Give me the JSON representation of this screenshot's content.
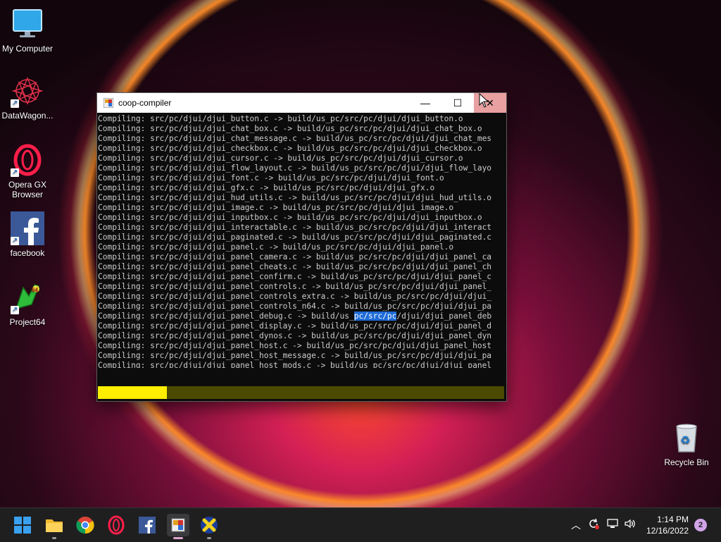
{
  "desktop_icons": [
    {
      "label": "My Computer",
      "icon": "monitor-icon",
      "shortcut": false
    },
    {
      "label": "DataWagon...",
      "icon": "datawagon-icon",
      "shortcut": true
    },
    {
      "label": "Opera GX Browser",
      "icon": "opera-gx-icon",
      "shortcut": true
    },
    {
      "label": "facebook",
      "icon": "facebook-icon",
      "shortcut": true
    },
    {
      "label": "Project64",
      "icon": "project64-icon",
      "shortcut": true
    },
    {
      "label": "Recycle Bin",
      "icon": "recycle-bin-icon",
      "shortcut": false
    }
  ],
  "window": {
    "title": "coop-compiler",
    "minimize_glyph": "—",
    "maximize_glyph": "☐",
    "close_glyph": "✕",
    "console_lines": [
      "Compiling: src/pc/djui/djui_button.c -> build/us_pc/src/pc/djui/djui_button.o",
      "Compiling: src/pc/djui/djui_chat_box.c -> build/us_pc/src/pc/djui/djui_chat_box.o",
      "Compiling: src/pc/djui/djui_chat_message.c -> build/us_pc/src/pc/djui/djui_chat_mes",
      "Compiling: src/pc/djui/djui_checkbox.c -> build/us_pc/src/pc/djui/djui_checkbox.o",
      "Compiling: src/pc/djui/djui_cursor.c -> build/us_pc/src/pc/djui/djui_cursor.o",
      "Compiling: src/pc/djui/djui_flow_layout.c -> build/us_pc/src/pc/djui/djui_flow_layo",
      "Compiling: src/pc/djui/djui_font.c -> build/us_pc/src/pc/djui/djui_font.o",
      "Compiling: src/pc/djui/djui_gfx.c -> build/us_pc/src/pc/djui/djui_gfx.o",
      "Compiling: src/pc/djui/djui_hud_utils.c -> build/us_pc/src/pc/djui/djui_hud_utils.o",
      "Compiling: src/pc/djui/djui_image.c -> build/us_pc/src/pc/djui/djui_image.o",
      "Compiling: src/pc/djui/djui_inputbox.c -> build/us_pc/src/pc/djui/djui_inputbox.o",
      "Compiling: src/pc/djui/djui_interactable.c -> build/us_pc/src/pc/djui/djui_interact",
      "Compiling: src/pc/djui/djui_paginated.c -> build/us_pc/src/pc/djui/djui_paginated.c",
      "Compiling: src/pc/djui/djui_panel.c -> build/us_pc/src/pc/djui/djui_panel.o",
      "Compiling: src/pc/djui/djui_panel_camera.c -> build/us_pc/src/pc/djui/djui_panel_ca",
      "Compiling: src/pc/djui/djui_panel_cheats.c -> build/us_pc/src/pc/djui/djui_panel_ch",
      "Compiling: src/pc/djui/djui_panel_confirm.c -> build/us_pc/src/pc/djui/djui_panel_c",
      "Compiling: src/pc/djui/djui_panel_controls.c -> build/us_pc/src/pc/djui/djui_panel_",
      "Compiling: src/pc/djui/djui_panel_controls_extra.c -> build/us_pc/src/pc/djui/djui_",
      "Compiling: src/pc/djui/djui_panel_controls_n64.c -> build/us_pc/src/pc/djui/djui_pa",
      "Compiling: src/pc/djui/djui_panel_debug.c -> build/us_pc/src/pc/djui/djui_panel_deb",
      "Compiling: src/pc/djui/djui_panel_display.c -> build/us_pc/src/pc/djui/djui_panel_d",
      "Compiling: src/pc/djui/djui_panel_dynos.c -> build/us_pc/src/pc/djui/djui_panel_dyn",
      "Compiling: src/pc/djui/djui_panel_host.c -> build/us_pc/src/pc/djui/djui_panel_host",
      "Compiling: src/pc/djui/djui_panel_host_message.c -> build/us_pc/src/pc/djui/djui_pa",
      "Compiling: src/pc/djui/djui_panel_host_mods.c -> build/us_pc/src/pc/djui/djui_panel"
    ],
    "selected_text": "pc/src/pc",
    "progress_fraction": 0.17,
    "progress_color": "#ffee00",
    "progress_track_color": "#4b4a00"
  },
  "taskbar": {
    "items": [
      {
        "icon": "windows-start-icon",
        "active": false,
        "indicator": false
      },
      {
        "icon": "file-explorer-icon",
        "active": false,
        "indicator": true
      },
      {
        "icon": "chrome-icon",
        "active": false,
        "indicator": false
      },
      {
        "icon": "opera-gx-icon",
        "active": false,
        "indicator": false
      },
      {
        "icon": "facebook-icon",
        "active": false,
        "indicator": false
      },
      {
        "icon": "coop-compiler-icon",
        "active": true,
        "indicator": true
      },
      {
        "icon": "project64-icon",
        "active": false,
        "indicator": true
      }
    ],
    "tray": {
      "chevron_glyph": "︿",
      "time": "1:14 PM",
      "date": "12/16/2022",
      "notification_count": "2"
    }
  }
}
